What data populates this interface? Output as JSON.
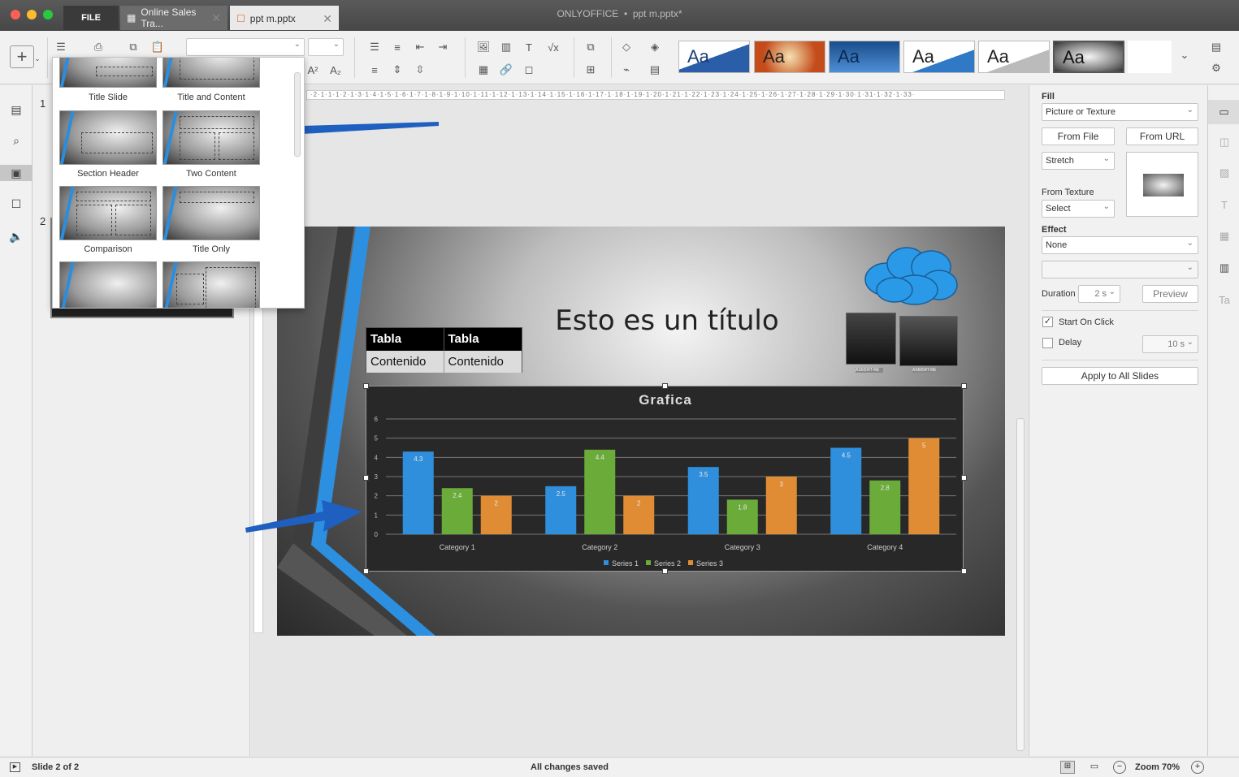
{
  "window": {
    "title": "ONLYOFFICE",
    "doc": "ppt m.pptx*",
    "sep": "•"
  },
  "tabs": {
    "file": "FILE",
    "tab1": "Online Sales Tra...",
    "tab2": "ppt m.pptx"
  },
  "themes": [
    "Aa",
    "Aa",
    "Aa",
    "Aa",
    "Aa",
    "Aa"
  ],
  "toolbar": {
    "superscript": "A²",
    "subscript": "A₂"
  },
  "thumbs": {
    "n1": "1",
    "n2": "2"
  },
  "layouts": {
    "l1": "Title Slide",
    "l2": "Title and Content",
    "l3": "Section Header",
    "l4": "Two Content",
    "l5": "Comparison",
    "l6": "Title Only"
  },
  "ruler": "·2·1·1·1·2·1·3·1·4·1·5·1·6·1·7·1·8·1·9·1·10·1·11·1·12·1·13·1·14·1·15·1·16·1·17·1·18·1·19·1·20·1·21·1·22·1·23·1·24·1·25·1·26·1·27·1·28·1·29·1·30·1·31·1·32·1·33·",
  "slide": {
    "title": "Esto es un título",
    "table": {
      "h1": "Tabla",
      "h2": "Tabla",
      "c1": "Contenido",
      "c2": "Contenido"
    },
    "server_labels": {
      "a": "AS6004T-RE",
      "b": "AS6004T-RE"
    }
  },
  "chart_data": {
    "type": "bar",
    "title": "Grafica",
    "categories": [
      "Category 1",
      "Category 2",
      "Category 3",
      "Category 4"
    ],
    "series": [
      {
        "name": "Series 1",
        "values": [
          4.3,
          2.5,
          3.5,
          4.5
        ],
        "color": "#2f8fdc"
      },
      {
        "name": "Series 2",
        "values": [
          2.4,
          4.4,
          1.8,
          2.8
        ],
        "color": "#6aab3a"
      },
      {
        "name": "Series 3",
        "values": [
          2,
          2,
          3,
          5
        ],
        "color": "#e08c34"
      }
    ],
    "ylim": [
      0,
      6
    ],
    "yticks": [
      "0",
      "1",
      "2",
      "3",
      "4",
      "5",
      "6"
    ],
    "legend": "bottom",
    "grid": true
  },
  "right_panel": {
    "fill_label": "Fill",
    "fill_value": "Picture or Texture",
    "from_file": "From File",
    "from_url": "From URL",
    "stretch": "Stretch",
    "from_texture": "From Texture",
    "select": "Select",
    "effect_label": "Effect",
    "effect_value": "None",
    "duration_label": "Duration",
    "duration_value": "2 s",
    "preview": "Preview",
    "start_on_click": "Start On Click",
    "delay": "Delay",
    "delay_value": "10 s",
    "apply_all": "Apply to All Slides"
  },
  "status": {
    "slide": "Slide 2 of 2",
    "saved": "All changes saved",
    "zoom": "Zoom 70%"
  }
}
